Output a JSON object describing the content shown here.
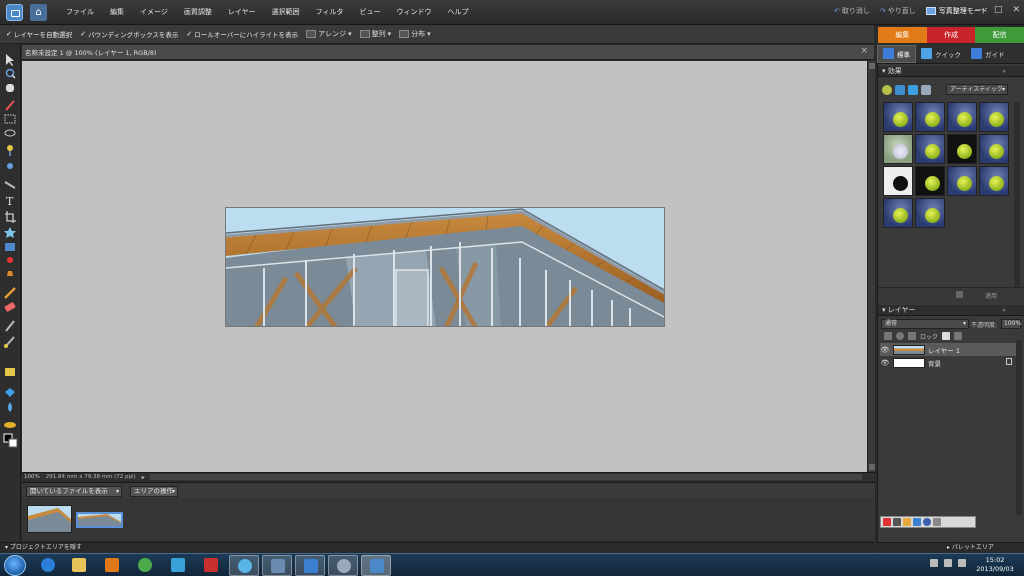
{
  "colors": {
    "accent_edit": "#e07b18",
    "accent_create": "#c8242c",
    "accent_share": "#3f9a3a",
    "canvas_bg": "#c2c2c2",
    "panel_bg": "#3a3a3a"
  },
  "menubar": {
    "items": [
      "ファイル",
      "編集",
      "イメージ",
      "画質調整",
      "レイヤー",
      "選択範囲",
      "フィルタ",
      "ビュー",
      "ウィンドウ",
      "ヘルプ"
    ],
    "undo_label": "取り消し",
    "redo_label": "やり直し",
    "organizer_label": "写真整理モード"
  },
  "options_bar": {
    "auto_select": "レイヤーを自動選択",
    "bounding_box": "バウンディングボックスを表示",
    "rollover": "ロールオーバーにハイライトを表示",
    "arrange": "アレンジ",
    "align": "整列",
    "distribute": "分布"
  },
  "mode_tabs": [
    "編集",
    "作成",
    "配信"
  ],
  "document": {
    "title": "名称未設定 1 @ 100% (レイヤー 1, RGB/8)",
    "zoom": "100%",
    "dimensions": "291.84 mm x 79.38 mm (72 ppi)"
  },
  "project_bin": {
    "show_select": "開いているファイルを表示",
    "bin_actions": "エリアの操作",
    "hide_label": "プロジェクトエリアを隠す"
  },
  "right_panel": {
    "edit_modes": [
      "標準",
      "クイック",
      "ガイド"
    ],
    "effects_header": "効果",
    "effects_category": "アーティスティック",
    "apply_label": "適用",
    "layers_header": "レイヤー",
    "blend_mode": "通常",
    "opacity_label": "不透明度:",
    "opacity_value": "100%",
    "lock_label": "ロック",
    "layers": [
      {
        "name": "レイヤー 1",
        "selected": true,
        "locked": false
      },
      {
        "name": "背景",
        "selected": false,
        "locked": true
      }
    ],
    "palette_bin_label": "パレットエリア"
  },
  "taskbar": {
    "time": "15:02",
    "date": "2013/09/03"
  }
}
